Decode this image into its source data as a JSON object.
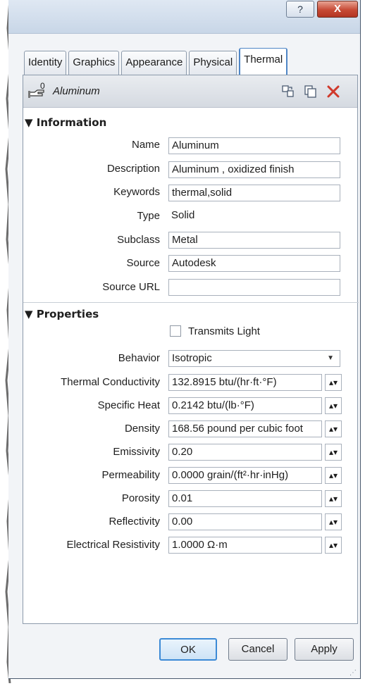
{
  "titlebar": {
    "help_label": "?",
    "close_label": "X"
  },
  "tabs": [
    {
      "label": "Identity",
      "active": false
    },
    {
      "label": "Graphics",
      "active": false
    },
    {
      "label": "Appearance",
      "active": false
    },
    {
      "label": "Physical",
      "active": false
    },
    {
      "label": "Thermal",
      "active": true
    }
  ],
  "material": {
    "count": "0",
    "name": "Aluminum"
  },
  "information": {
    "heading": "▼ Information",
    "name_label": "Name",
    "name_value": "Aluminum",
    "description_label": "Description",
    "description_value": "Aluminum , oxidized finish",
    "keywords_label": "Keywords",
    "keywords_value": "thermal,solid",
    "type_label": "Type",
    "type_value": "Solid",
    "subclass_label": "Subclass",
    "subclass_value": "Metal",
    "source_label": "Source",
    "source_value": "Autodesk",
    "source_url_label": "Source URL",
    "source_url_value": ""
  },
  "properties": {
    "heading": "▼ Properties",
    "transmits_light_label": "Transmits Light",
    "transmits_light_checked": false,
    "behavior_label": "Behavior",
    "behavior_value": "Isotropic",
    "thermal_conductivity_label": "Thermal Conductivity",
    "thermal_conductivity_value": "132.8915 btu/(hr·ft·°F)",
    "specific_heat_label": "Specific Heat",
    "specific_heat_value": "0.2142 btu/(lb·°F)",
    "density_label": "Density",
    "density_value": "168.56 pound per cubic foot",
    "emissivity_label": "Emissivity",
    "emissivity_value": "0.20",
    "permeability_label": "Permeability",
    "permeability_value": "0.0000 grain/(ft²·hr·inHg)",
    "porosity_label": "Porosity",
    "porosity_value": "0.01",
    "reflectivity_label": "Reflectivity",
    "reflectivity_value": "0.00",
    "electrical_resistivity_label": "Electrical Resistivity",
    "electrical_resistivity_value": "1.0000 Ω·m",
    "spinner_glyph": "▴▾"
  },
  "footer": {
    "ok_label": "OK",
    "cancel_label": "Cancel",
    "apply_label": "Apply"
  },
  "colors": {
    "accent": "#3c8ad6",
    "close": "#c74a35",
    "delete": "#d0392b"
  },
  "icons": [
    "hand-icon",
    "duplicate-icon",
    "copy-icon",
    "delete-icon",
    "dropdown-arrow-icon",
    "spinner-icon",
    "resize-grip-icon"
  ]
}
